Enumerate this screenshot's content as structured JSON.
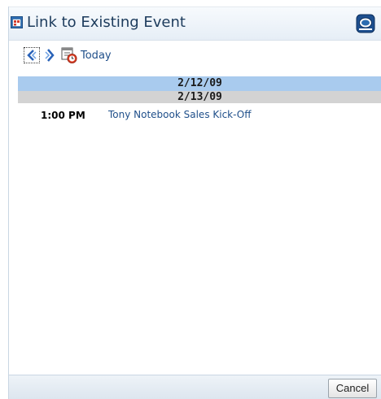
{
  "dialog": {
    "title": "Link to Existing Event",
    "title_icon": "calendar-event-icon",
    "close_icon": "close-icon"
  },
  "toolbar": {
    "prev_icon": "chevron-left-icon",
    "next_icon": "chevron-right-icon",
    "today_icon": "calendar-clock-icon",
    "today_label": "Today"
  },
  "calendar": {
    "days": [
      {
        "date": "2/12/09",
        "events": []
      },
      {
        "date": "2/13/09",
        "events": [
          {
            "time": "1:00 PM",
            "title": "Tony Notebook Sales Kick-Off"
          }
        ]
      }
    ]
  },
  "footer": {
    "cancel_label": "Cancel"
  },
  "colors": {
    "title_text": "#1c3b5c",
    "link": "#1f4f8a",
    "selected_day_bg": "#a9cbee",
    "day_header_bg": "#d3d3d3"
  }
}
